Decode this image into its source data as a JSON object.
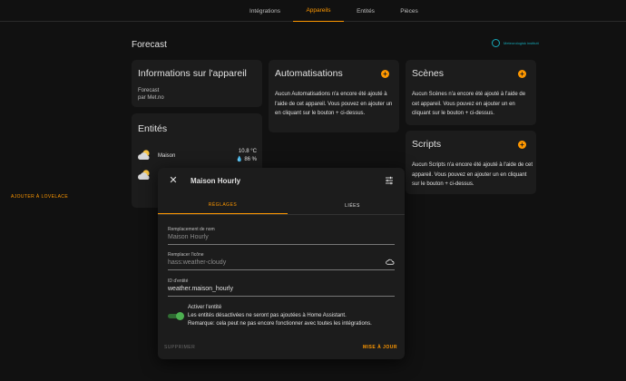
{
  "tabs": [
    {
      "label": "Intégrations"
    },
    {
      "label": "Appareils"
    },
    {
      "label": "Entités"
    },
    {
      "label": "Pièces"
    }
  ],
  "page": {
    "title": "Forecast"
  },
  "brand": {
    "text": "Meteorologisk institutt",
    "color": "#16a9b8"
  },
  "device_info": {
    "title": "Informations sur l'appareil",
    "model": "Forecast",
    "by": "par Met.no"
  },
  "entities": {
    "title": "Entités",
    "rows": [
      {
        "name": "Maison",
        "temperature": "10.8 °C",
        "humidity": "86 %",
        "icon": "weather-partly-cloudy-icon"
      },
      {
        "name": "",
        "temperature": "",
        "humidity": "",
        "icon": "weather-partly-cloudy-icon"
      }
    ],
    "add_label": "AJOUTER À LOVELACE"
  },
  "automations": {
    "title": "Automatisations",
    "text": "Aucun Automatisations n'a encore été ajouté à l'aide de cet appareil. Vous pouvez en ajouter un en cliquant sur le bouton + ci-dessus."
  },
  "scenes": {
    "title": "Scènes",
    "text": "Aucun Scènes n'a encore été ajouté à l'aide de cet appareil. Vous pouvez en ajouter un en cliquant sur le bouton + ci-dessus."
  },
  "scripts": {
    "title": "Scripts",
    "text": "Aucun Scripts n'a encore été ajouté à l'aide de cet appareil. Vous pouvez en ajouter un en cliquant sur le bouton + ci-dessus."
  },
  "dialog": {
    "title": "Maison Hourly",
    "tabs": [
      {
        "label": "RÉGLAGES"
      },
      {
        "label": "LIÉES"
      }
    ],
    "fields": {
      "name": {
        "label": "Remplacement de nom",
        "value": "Maison Hourly"
      },
      "icon": {
        "label": "Remplacer l'icône",
        "value": "hass:weather-cloudy"
      },
      "entity_id": {
        "label": "ID d'entité",
        "value": "weather.maison_hourly"
      }
    },
    "enable": {
      "title": "Activer l'entité",
      "line1": "Les entités désactivées ne seront pas ajoutées à Home Assistant.",
      "line2": "Remarque: cela peut ne pas encore fonctionner avec toutes les intégrations.",
      "checked": true
    },
    "delete_label": "SUPPRIMER",
    "update_label": "MISE À JOUR"
  },
  "colors": {
    "accent": "#ff9800",
    "toggle_on": "#4caf50",
    "background": "#111111",
    "card": "#1c1c1c"
  }
}
